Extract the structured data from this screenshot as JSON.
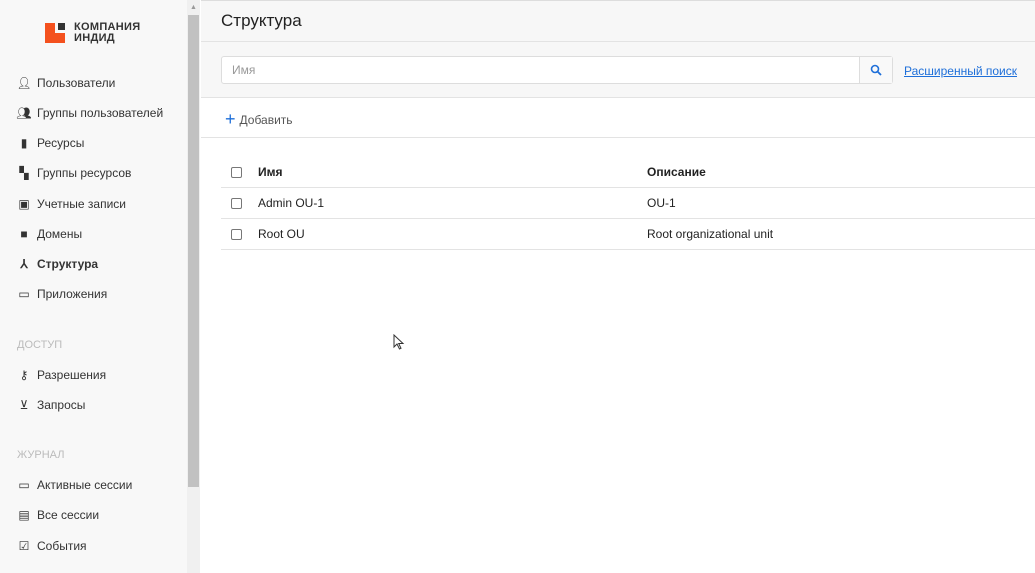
{
  "brand": {
    "line1": "КОМПАНИЯ",
    "line2": "ИНДИД",
    "color": "#f4511e"
  },
  "sidebar": {
    "items": [
      {
        "label": "Пользователи",
        "icon": "user-icon"
      },
      {
        "label": "Группы пользователей",
        "icon": "users-icon"
      },
      {
        "label": "Ресурсы",
        "icon": "server-icon"
      },
      {
        "label": "Группы ресурсов",
        "icon": "server-group-icon"
      },
      {
        "label": "Учетные записи",
        "icon": "account-badge-icon"
      },
      {
        "label": "Домены",
        "icon": "folder-user-icon"
      },
      {
        "label": "Структура",
        "icon": "hierarchy-icon",
        "active": true
      },
      {
        "label": "Приложения",
        "icon": "app-monitor-icon"
      }
    ],
    "access_title": "ДОСТУП",
    "access": [
      {
        "label": "Разрешения",
        "icon": "key-list-icon"
      },
      {
        "label": "Запросы",
        "icon": "inbox-download-icon"
      }
    ],
    "journal_title": "ЖУРНАЛ",
    "journal": [
      {
        "label": "Активные сессии",
        "icon": "monitor-icon"
      },
      {
        "label": "Все сессии",
        "icon": "document-search-icon"
      },
      {
        "label": "События",
        "icon": "calendar-check-icon"
      }
    ]
  },
  "page": {
    "title": "Структура",
    "search_placeholder": "Имя",
    "advanced_search": "Расширенный поиск",
    "add_label": "Добавить"
  },
  "table": {
    "columns": [
      "Имя",
      "Описание"
    ],
    "rows": [
      [
        "Admin OU-1",
        "OU-1"
      ],
      [
        "Root OU",
        "Root organizational unit"
      ]
    ]
  }
}
